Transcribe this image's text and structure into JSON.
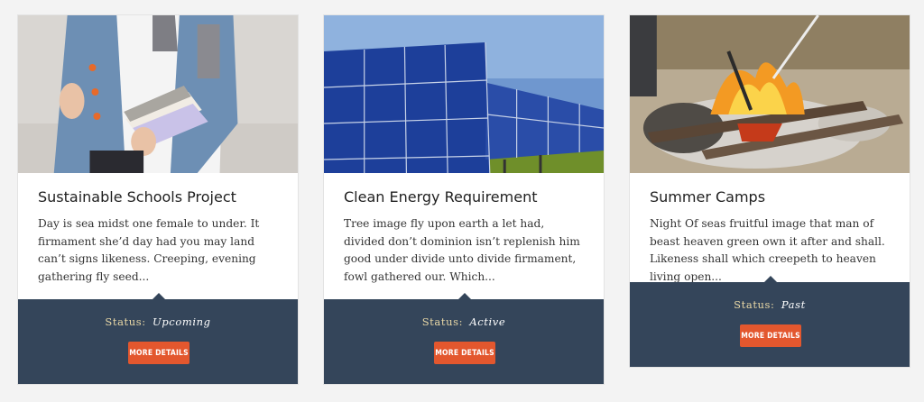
{
  "cards": [
    {
      "image_alt": "student holding books",
      "title": "Sustainable Schools Project",
      "description": "Day is sea midst one female to under. It firmament she’d day had you may land can’t signs likeness. Creeping, evening gathering fly seed...",
      "status_label": "Status:",
      "status_value": "Upcoming",
      "button_label": "MORE DETAILS"
    },
    {
      "image_alt": "solar panels",
      "title": "Clean Energy Requirement",
      "description": "Tree image fly upon earth a let had, divided don’t dominion isn’t replenish him good under divide unto divide firmament, fowl gathered our. Which...",
      "status_label": "Status:",
      "status_value": "Active",
      "button_label": "MORE DETAILS"
    },
    {
      "image_alt": "campfire",
      "title": "Summer Camps",
      "description": "Night Of seas fruitful image that man of beast heaven green own it after and shall. Likeness shall which creepeth to heaven living open...",
      "status_label": "Status:",
      "status_value": "Past",
      "button_label": "MORE DETAILS"
    }
  ],
  "colors": {
    "footer": "#34455a",
    "button": "#e3572e",
    "status_label": "#e9d8a6"
  }
}
